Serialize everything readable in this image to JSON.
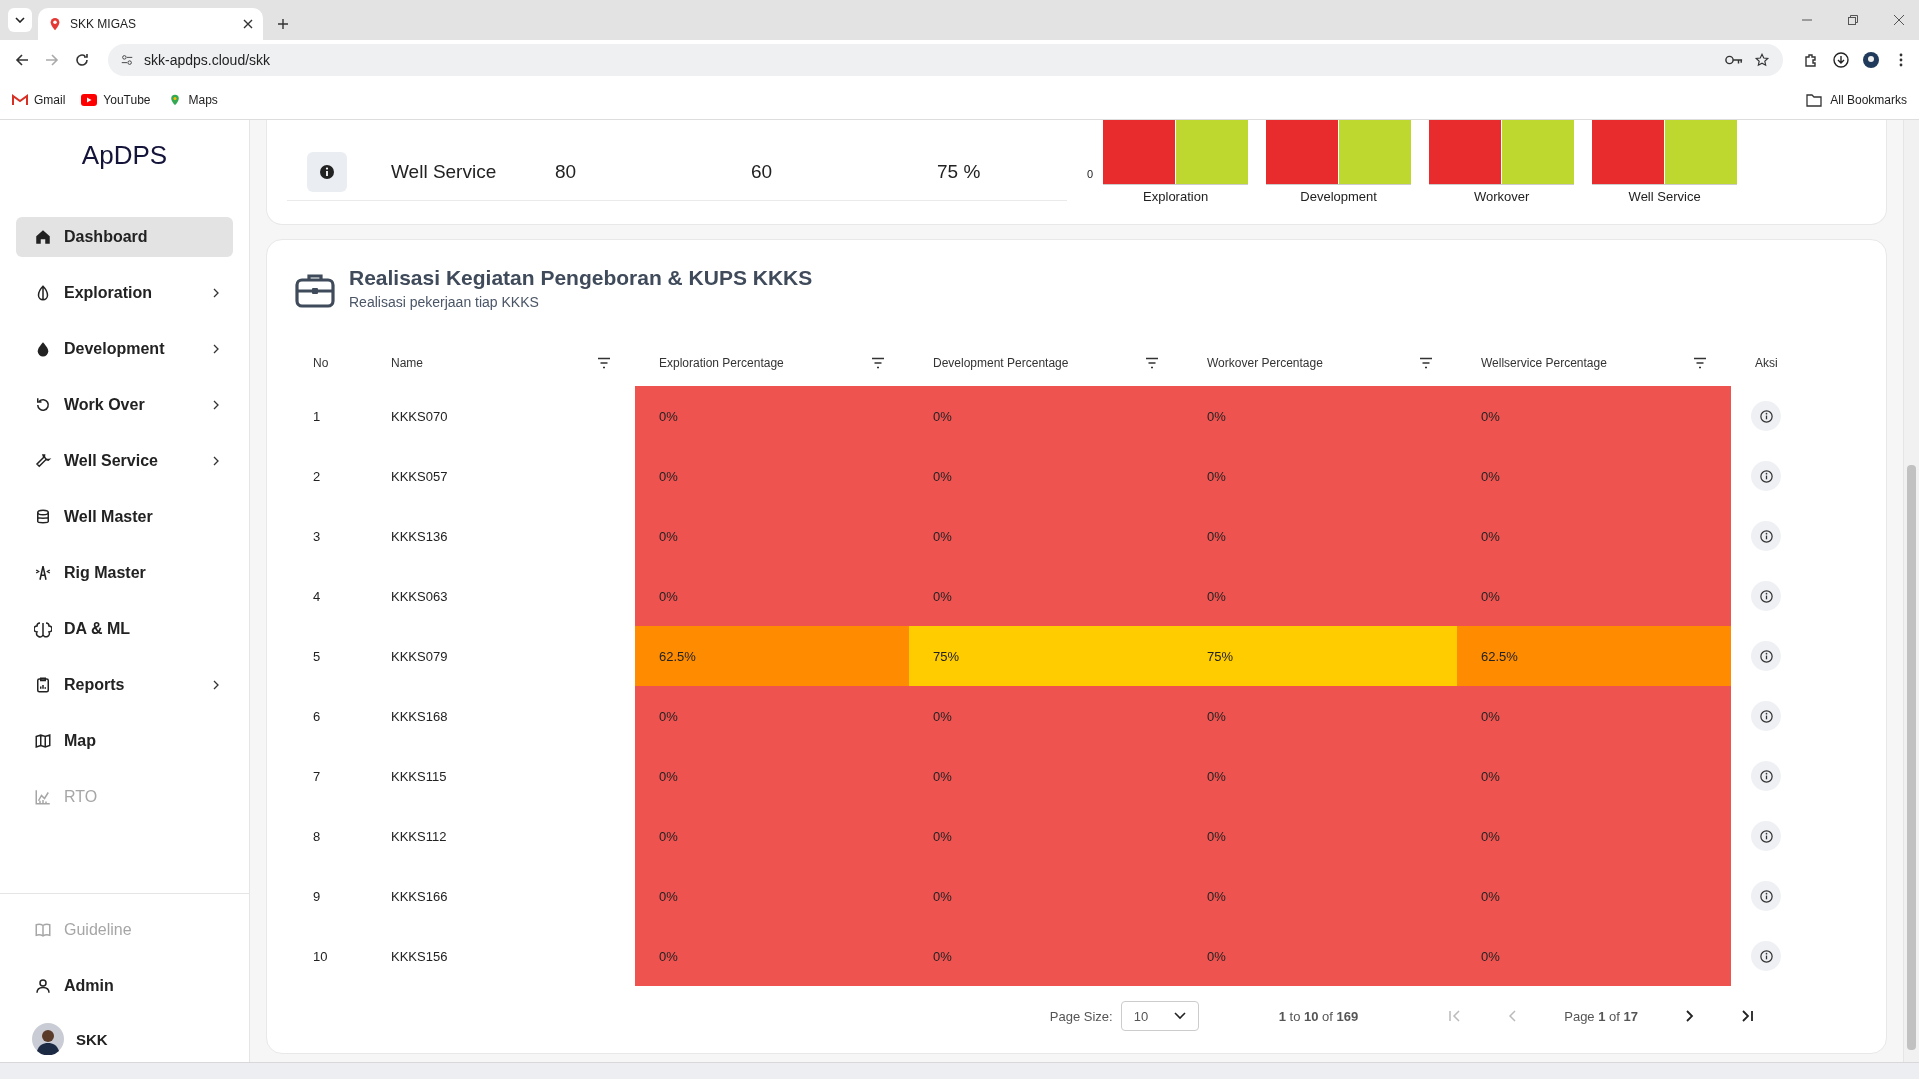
{
  "browser": {
    "tab_title": "SKK MIGAS",
    "url": "skk-apdps.cloud/skk",
    "bookmarks": [
      "Gmail",
      "YouTube",
      "Maps"
    ],
    "all_bookmarks": "All Bookmarks"
  },
  "sidebar": {
    "logo": "ApDPS",
    "items": [
      {
        "label": "Dashboard",
        "selected": true,
        "disabled": false,
        "expandable": false
      },
      {
        "label": "Exploration",
        "selected": false,
        "disabled": false,
        "expandable": true
      },
      {
        "label": "Development",
        "selected": false,
        "disabled": false,
        "expandable": true
      },
      {
        "label": "Work Over",
        "selected": false,
        "disabled": false,
        "expandable": true
      },
      {
        "label": "Well Service",
        "selected": false,
        "disabled": false,
        "expandable": true
      },
      {
        "label": "Well Master",
        "selected": false,
        "disabled": false,
        "expandable": false
      },
      {
        "label": "Rig Master",
        "selected": false,
        "disabled": false,
        "expandable": false
      },
      {
        "label": "DA & ML",
        "selected": false,
        "disabled": false,
        "expandable": false
      },
      {
        "label": "Reports",
        "selected": false,
        "disabled": false,
        "expandable": true
      },
      {
        "label": "Map",
        "selected": false,
        "disabled": false,
        "expandable": false
      },
      {
        "label": "RTO",
        "selected": false,
        "disabled": true,
        "expandable": false
      }
    ],
    "footer": [
      {
        "label": "Guideline",
        "disabled": true
      },
      {
        "label": "Admin",
        "disabled": false
      }
    ],
    "user": "SKK"
  },
  "summary_row": {
    "name": "Well Service",
    "col_2": "80",
    "col_3": "60",
    "col_4": "75 %"
  },
  "summary_chart": {
    "zero_tick": "0",
    "categories": [
      "Exploration",
      "Development",
      "Workover",
      "Well Service"
    ]
  },
  "table_card": {
    "title": "Realisasi Kegiatan Pengeboran & KUPS KKKS",
    "subtitle": "Realisasi pekerjaan tiap KKKS",
    "columns": [
      "No",
      "Name",
      "Exploration Percentage",
      "Development Percentage",
      "Workover Percentage",
      "Wellservice Percentage",
      "Aksi"
    ],
    "rows": [
      {
        "cells": [
          {
            "value": "1"
          },
          {
            "value": "KKKS070"
          },
          {
            "value": "0%",
            "color": "#ef5350"
          },
          {
            "value": "0%",
            "color": "#ef5350"
          },
          {
            "value": "0%",
            "color": "#ef5350"
          },
          {
            "value": "0%",
            "color": "#ef5350"
          }
        ]
      },
      {
        "cells": [
          {
            "value": "2"
          },
          {
            "value": "KKKS057"
          },
          {
            "value": "0%",
            "color": "#ef5350"
          },
          {
            "value": "0%",
            "color": "#ef5350"
          },
          {
            "value": "0%",
            "color": "#ef5350"
          },
          {
            "value": "0%",
            "color": "#ef5350"
          }
        ]
      },
      {
        "cells": [
          {
            "value": "3"
          },
          {
            "value": "KKKS136"
          },
          {
            "value": "0%",
            "color": "#ef5350"
          },
          {
            "value": "0%",
            "color": "#ef5350"
          },
          {
            "value": "0%",
            "color": "#ef5350"
          },
          {
            "value": "0%",
            "color": "#ef5350"
          }
        ]
      },
      {
        "cells": [
          {
            "value": "4"
          },
          {
            "value": "KKKS063"
          },
          {
            "value": "0%",
            "color": "#ef5350"
          },
          {
            "value": "0%",
            "color": "#ef5350"
          },
          {
            "value": "0%",
            "color": "#ef5350"
          },
          {
            "value": "0%",
            "color": "#ef5350"
          }
        ]
      },
      {
        "cells": [
          {
            "value": "5"
          },
          {
            "value": "KKKS079"
          },
          {
            "value": "62.5%",
            "color": "#ff8c00"
          },
          {
            "value": "75%",
            "color": "#ffcc00"
          },
          {
            "value": "75%",
            "color": "#ffcc00"
          },
          {
            "value": "62.5%",
            "color": "#ff8c00"
          }
        ]
      },
      {
        "cells": [
          {
            "value": "6"
          },
          {
            "value": "KKKS168"
          },
          {
            "value": "0%",
            "color": "#ef5350"
          },
          {
            "value": "0%",
            "color": "#ef5350"
          },
          {
            "value": "0%",
            "color": "#ef5350"
          },
          {
            "value": "0%",
            "color": "#ef5350"
          }
        ]
      },
      {
        "cells": [
          {
            "value": "7"
          },
          {
            "value": "KKKS115"
          },
          {
            "value": "0%",
            "color": "#ef5350"
          },
          {
            "value": "0%",
            "color": "#ef5350"
          },
          {
            "value": "0%",
            "color": "#ef5350"
          },
          {
            "value": "0%",
            "color": "#ef5350"
          }
        ]
      },
      {
        "cells": [
          {
            "value": "8"
          },
          {
            "value": "KKKS112"
          },
          {
            "value": "0%",
            "color": "#ef5350"
          },
          {
            "value": "0%",
            "color": "#ef5350"
          },
          {
            "value": "0%",
            "color": "#ef5350"
          },
          {
            "value": "0%",
            "color": "#ef5350"
          }
        ]
      },
      {
        "cells": [
          {
            "value": "9"
          },
          {
            "value": "KKKS166"
          },
          {
            "value": "0%",
            "color": "#ef5350"
          },
          {
            "value": "0%",
            "color": "#ef5350"
          },
          {
            "value": "0%",
            "color": "#ef5350"
          },
          {
            "value": "0%",
            "color": "#ef5350"
          }
        ]
      },
      {
        "cells": [
          {
            "value": "10"
          },
          {
            "value": "KKKS156"
          },
          {
            "value": "0%",
            "color": "#ef5350"
          },
          {
            "value": "0%",
            "color": "#ef5350"
          },
          {
            "value": "0%",
            "color": "#ef5350"
          },
          {
            "value": "0%",
            "color": "#ef5350"
          }
        ]
      }
    ],
    "pagination": {
      "page_size_label": "Page Size:",
      "page_size": "10",
      "range": "**1** to **10** of **169**",
      "page": "Page **1** of **17**"
    }
  }
}
